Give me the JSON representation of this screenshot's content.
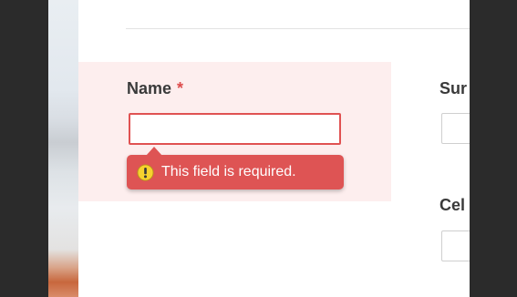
{
  "form": {
    "name_label": "Name",
    "required_marker": "*",
    "name_value": "",
    "error_message": "This field is required.",
    "surname_label": "Sur",
    "cell_label": "Cel"
  },
  "icons": {
    "warning": "warning-icon"
  },
  "colors": {
    "error": "#de5454",
    "error_background": "#fdeeee",
    "label": "#3a3a3a"
  }
}
